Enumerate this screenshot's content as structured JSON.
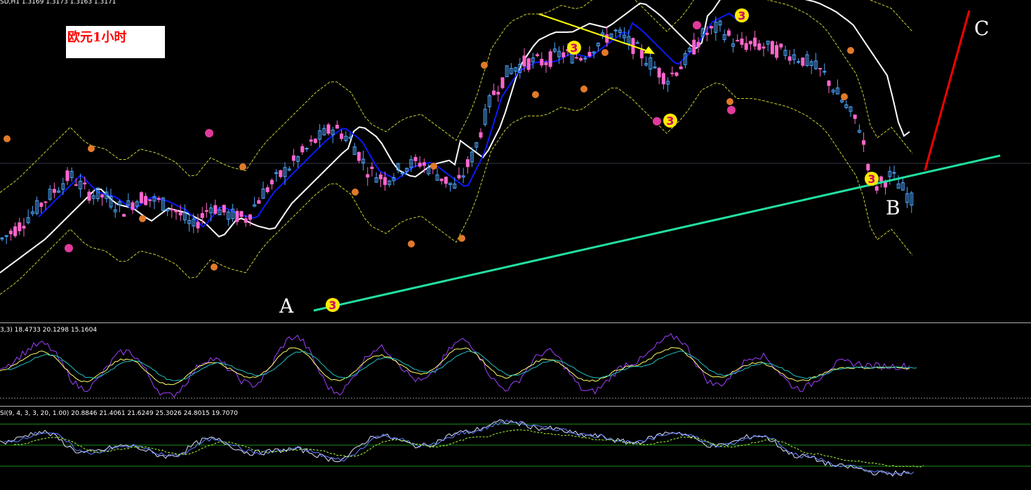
{
  "header": {
    "main": "SD,H1  1.3169 1.3173 1.3163 1.3171",
    "stoch": "3,3) 18.4733 20.1298 15.1604",
    "kdj": "SI(9, 4, 3, 3, 20, 1.00) 20.8846 21.4061 21.6249 25.3026 24.8015 19.7070"
  },
  "title": "欧元1小时",
  "point_labels": {
    "a": "A",
    "b": "B",
    "c": "C"
  },
  "wave_label": "3",
  "colors": {
    "bg": "#000000",
    "bull": "#4da6ff",
    "bear": "#ff66cc",
    "ma_fast": "#0a1aff",
    "ma_slow": "#ffffff",
    "envelope": "#cccc33",
    "trend": "#22e0a0",
    "arrow_up": "#ff0000",
    "arrow_down": "#ffff00",
    "badge": "#ffea00",
    "small_orange": "#e07a2a",
    "small_magenta": "#e03a9a",
    "osc_purple": "#a040ff",
    "osc_yellow": "#ffff66",
    "osc_cyan": "#22c0c0",
    "osc_green": "#aaff33",
    "osc_white": "#e0e0ff",
    "osc_blue": "#6080ff",
    "level_green": "#1a8f1a",
    "sep": "#b0b0b0"
  },
  "chart_data": [
    {
      "type": "candlestick",
      "title": "欧元1小时",
      "series": [
        {
          "name": "price",
          "points": [
            [
              0,
              170
            ],
            [
              25,
              185
            ],
            [
              50,
              205
            ],
            [
              75,
              225
            ],
            [
              100,
              245
            ],
            [
              125,
              225
            ],
            [
              150,
              220
            ],
            [
              175,
              205
            ],
            [
              200,
              220
            ],
            [
              225,
              215
            ],
            [
              250,
              205
            ],
            [
              275,
              185
            ],
            [
              300,
              210
            ],
            [
              325,
              200
            ],
            [
              350,
              195
            ],
            [
              375,
              225
            ],
            [
              400,
              245
            ],
            [
              425,
              265
            ],
            [
              450,
              285
            ],
            [
              475,
              300
            ],
            [
              500,
              285
            ],
            [
              525,
              250
            ],
            [
              550,
              240
            ],
            [
              575,
              255
            ],
            [
              600,
              260
            ],
            [
              625,
              245
            ],
            [
              650,
              230
            ],
            [
              675,
              270
            ],
            [
              700,
              335
            ],
            [
              725,
              365
            ],
            [
              750,
              375
            ],
            [
              775,
              375
            ],
            [
              800,
              385
            ],
            [
              825,
              380
            ],
            [
              850,
              395
            ],
            [
              875,
              410
            ],
            [
              900,
              395
            ],
            [
              925,
              375
            ],
            [
              950,
              355
            ],
            [
              975,
              375
            ],
            [
              1000,
              405
            ],
            [
              1025,
              415
            ],
            [
              1050,
              395
            ],
            [
              1075,
              395
            ],
            [
              1100,
              390
            ],
            [
              1125,
              385
            ],
            [
              1150,
              375
            ],
            [
              1175,
              360
            ],
            [
              1200,
              330
            ],
            [
              1225,
              300
            ],
            [
              1245,
              230
            ],
            [
              1270,
              245
            ],
            [
              1300,
              215
            ]
          ]
        },
        {
          "name": "ma_fast",
          "points": [
            [
              55,
              100
            ],
            [
              80,
              115
            ],
            [
              110,
              140
            ],
            [
              140,
              195
            ],
            [
              170,
              225
            ],
            [
              200,
              250
            ],
            [
              245,
              263
            ],
            [
              270,
              250
            ],
            [
              300,
              225
            ],
            [
              340,
              195
            ],
            [
              380,
              170
            ],
            [
              420,
              140
            ],
            [
              470,
              100
            ],
            [
              510,
              80
            ],
            [
              560,
              62
            ],
            [
              610,
              55
            ],
            [
              660,
              58
            ],
            [
              700,
              80
            ],
            [
              740,
              130
            ],
            [
              780,
              200
            ],
            [
              820,
              265
            ],
            [
              860,
              305
            ],
            [
              900,
              355
            ],
            [
              940,
              400
            ],
            [
              970,
              425
            ],
            [
              1000,
              445
            ],
            [
              1030,
              462
            ],
            [
              1055,
              465
            ]
          ]
        },
        {
          "name": "ma_slow",
          "points": [
            [
              0,
              150
            ],
            [
              50,
              140
            ],
            [
              100,
              150
            ],
            [
              150,
              175
            ],
            [
              200,
              205
            ],
            [
              250,
              225
            ],
            [
              300,
              220
            ],
            [
              350,
              200
            ],
            [
              400,
              185
            ],
            [
              450,
              165
            ],
            [
              500,
              140
            ],
            [
              550,
              110
            ],
            [
              600,
              90
            ],
            [
              650,
              80
            ],
            [
              700,
              75
            ],
            [
              750,
              80
            ],
            [
              800,
              87
            ],
            [
              850,
              90
            ],
            [
              900,
              85
            ],
            [
              950,
              77
            ],
            [
              1000,
              70
            ],
            [
              1050,
              68
            ],
            [
              1100,
              95
            ],
            [
              1150,
              120
            ],
            [
              1200,
              150
            ],
            [
              1250,
              200
            ],
            [
              1300,
              285
            ],
            [
              1350,
              345
            ],
            [
              1400,
              390
            ],
            [
              1450,
              420
            ],
            [
              1500,
              445
            ],
            [
              1530,
              448
            ],
            [
              1560,
              445
            ]
          ]
        }
      ]
    },
    {
      "type": "line",
      "title": "3,3) 18.4733 20.1298 15.1604",
      "series": [
        {
          "name": "purple",
          "points": [
            [
              0,
              50
            ],
            [
              60,
              80
            ],
            [
              120,
              20
            ],
            [
              180,
              70
            ],
            [
              240,
              10
            ],
            [
              300,
              60
            ],
            [
              360,
              25
            ],
            [
              420,
              90
            ],
            [
              480,
              15
            ],
            [
              540,
              75
            ],
            [
              600,
              30
            ],
            [
              660,
              85
            ],
            [
              720,
              20
            ],
            [
              780,
              70
            ],
            [
              840,
              15
            ],
            [
              900,
              55
            ],
            [
              960,
              90
            ],
            [
              1020,
              25
            ],
            [
              1080,
              65
            ],
            [
              1140,
              20
            ],
            [
              1200,
              55
            ],
            [
              1260,
              50
            ],
            [
              1300,
              50
            ]
          ]
        },
        {
          "name": "yellow",
          "points": [
            [
              0,
              45
            ],
            [
              60,
              70
            ],
            [
              120,
              30
            ],
            [
              180,
              60
            ],
            [
              240,
              25
            ],
            [
              300,
              55
            ],
            [
              360,
              35
            ],
            [
              420,
              75
            ],
            [
              480,
              30
            ],
            [
              540,
              65
            ],
            [
              600,
              40
            ],
            [
              660,
              75
            ],
            [
              720,
              35
            ],
            [
              780,
              60
            ],
            [
              840,
              30
            ],
            [
              900,
              50
            ],
            [
              960,
              75
            ],
            [
              1020,
              35
            ],
            [
              1080,
              55
            ],
            [
              1140,
              30
            ],
            [
              1200,
              48
            ],
            [
              1260,
              48
            ],
            [
              1300,
              48
            ]
          ]
        }
      ]
    },
    {
      "type": "line",
      "title": "SI(9, 4, 3, 3, 20, 1.00) 20.8846 21.4061 21.6249 25.3026 24.8015 19.7070",
      "series": [
        {
          "name": "main",
          "points": [
            [
              0,
              60
            ],
            [
              60,
              75
            ],
            [
              120,
              45
            ],
            [
              180,
              55
            ],
            [
              240,
              40
            ],
            [
              300,
              65
            ],
            [
              360,
              45
            ],
            [
              420,
              50
            ],
            [
              480,
              35
            ],
            [
              540,
              70
            ],
            [
              600,
              55
            ],
            [
              660,
              75
            ],
            [
              720,
              90
            ],
            [
              780,
              80
            ],
            [
              840,
              70
            ],
            [
              900,
              60
            ],
            [
              960,
              75
            ],
            [
              1020,
              55
            ],
            [
              1080,
              70
            ],
            [
              1140,
              40
            ],
            [
              1200,
              25
            ],
            [
              1260,
              15
            ],
            [
              1300,
              15
            ]
          ]
        }
      ]
    }
  ]
}
